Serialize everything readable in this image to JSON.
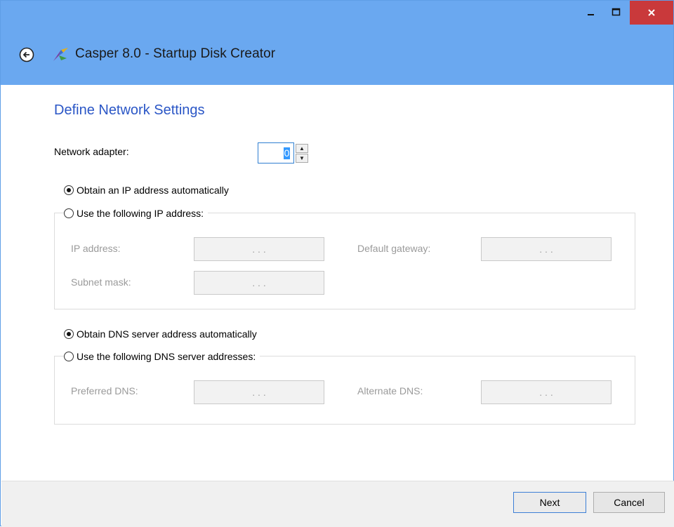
{
  "window": {
    "title": "Casper 8.0 - Startup Disk Creator",
    "controls": {
      "minimize": "_",
      "maximize": "☐",
      "close": "✕"
    }
  },
  "page": {
    "heading": "Define Network Settings",
    "network_adapter_label": "Network adapter:",
    "network_adapter_value": "0"
  },
  "ip": {
    "auto_label": "Obtain an IP address automatically",
    "auto_selected": true,
    "manual_label": "Use the following IP address:",
    "ip_address_label": "IP address:",
    "subnet_mask_label": "Subnet mask:",
    "default_gateway_label": "Default gateway:",
    "dots": ".    .    ."
  },
  "dns": {
    "auto_label": "Obtain DNS server address automatically",
    "auto_selected": true,
    "manual_label": "Use the following DNS server addresses:",
    "preferred_label": "Preferred DNS:",
    "alternate_label": "Alternate DNS:"
  },
  "footer": {
    "next_label": "Next",
    "cancel_label": "Cancel"
  },
  "colors": {
    "titlebar": "#6aa8f0",
    "close_button": "#c9393b",
    "heading": "#2a56c6",
    "footer": "#f0f0f0"
  }
}
